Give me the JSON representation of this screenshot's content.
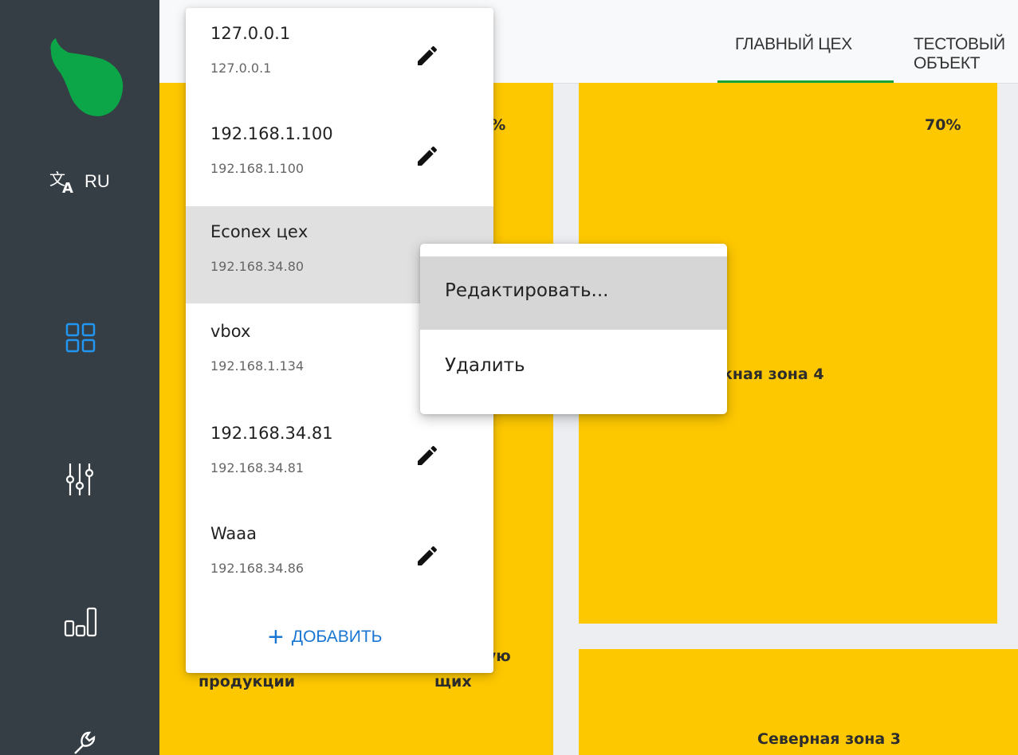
{
  "sidebar": {
    "language": "RU",
    "icons": [
      "pear-logo",
      "translate-icon",
      "dashboard-icon",
      "sliders-icon",
      "stats-icon",
      "wrench-icon"
    ],
    "accent_color": "#2196f3",
    "logo_color": "#0ca649"
  },
  "topbar": {
    "tabs": [
      {
        "label": "ГЛАВНЫЙ ЦЕХ",
        "active": true
      },
      {
        "label": "ТЕСТОВЫЙ ОБЪЕКТ",
        "active": false
      }
    ],
    "active_color": "#18a33a"
  },
  "zones": {
    "color": "#fec800",
    "zone_left_percent": "70%",
    "zone_right_percent": "70%",
    "zone_south_name": "жная зона 4",
    "zone_north_name": "Северная зона 3",
    "left_label_line1": "продукции",
    "left_label_part2": "гую",
    "left_label_part3": "щих",
    "left_percent_visible": "0%"
  },
  "server_menu": {
    "servers": [
      {
        "name": "127.0.0.1",
        "address": "127.0.0.1"
      },
      {
        "name": "192.168.1.100",
        "address": "192.168.1.100"
      },
      {
        "name": "Econex цех",
        "address": "192.168.34.80"
      },
      {
        "name": "vbox",
        "address": "192.168.1.134"
      },
      {
        "name": "192.168.34.81",
        "address": "192.168.34.81"
      },
      {
        "name": "Waaa",
        "address": "192.168.34.86"
      }
    ],
    "selected_index": 2,
    "add_label": "ДОБАВИТЬ"
  },
  "context_menu": {
    "edit_label": "Редактировать...",
    "delete_label": "Удалить"
  }
}
